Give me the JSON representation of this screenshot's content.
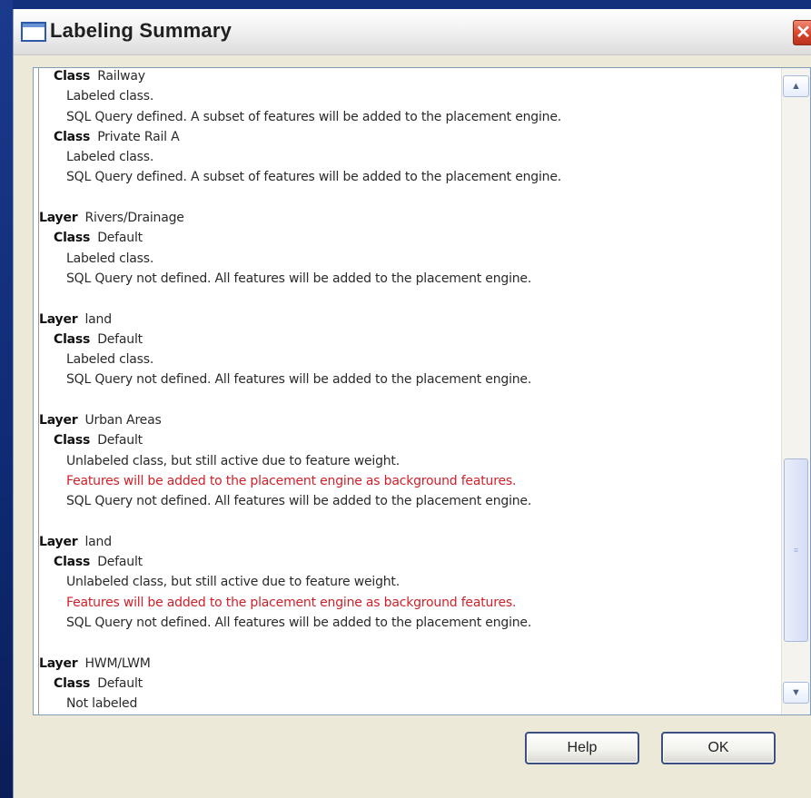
{
  "window": {
    "title": "Labeling Summary",
    "close_symbol": "✕"
  },
  "summary": {
    "rows": [
      {
        "kind": "class",
        "keyword": "Class",
        "name": "Railway"
      },
      {
        "kind": "msg",
        "text": "Labeled class."
      },
      {
        "kind": "msg",
        "text": "SQL Query defined. A subset of features will be added to the placement engine."
      },
      {
        "kind": "class",
        "keyword": "Class",
        "name": "Private Rail A"
      },
      {
        "kind": "msg",
        "text": "Labeled class."
      },
      {
        "kind": "msg",
        "text": "SQL Query defined. A subset of features will be added to the placement engine."
      },
      {
        "kind": "gap"
      },
      {
        "kind": "layer",
        "keyword": "Layer",
        "name": "Rivers/Drainage"
      },
      {
        "kind": "class",
        "keyword": "Class",
        "name": "Default"
      },
      {
        "kind": "msg",
        "text": "Labeled class."
      },
      {
        "kind": "msg",
        "text": "SQL Query not defined. All features will be added to the placement engine."
      },
      {
        "kind": "gap"
      },
      {
        "kind": "layer",
        "keyword": "Layer",
        "name": "land"
      },
      {
        "kind": "class",
        "keyword": "Class",
        "name": "Default"
      },
      {
        "kind": "msg",
        "text": "Labeled class."
      },
      {
        "kind": "msg",
        "text": "SQL Query not defined. All features will be added to the placement engine."
      },
      {
        "kind": "gap"
      },
      {
        "kind": "layer",
        "keyword": "Layer",
        "name": "Urban Areas"
      },
      {
        "kind": "class",
        "keyword": "Class",
        "name": "Default"
      },
      {
        "kind": "msg",
        "text": "Unlabeled class, but still active due to feature weight."
      },
      {
        "kind": "warn",
        "text": "Features will be added to the placement engine as background features."
      },
      {
        "kind": "msg",
        "text": "SQL Query not defined. All features will be added to the placement engine."
      },
      {
        "kind": "gap"
      },
      {
        "kind": "layer",
        "keyword": "Layer",
        "name": "land"
      },
      {
        "kind": "class",
        "keyword": "Class",
        "name": "Default"
      },
      {
        "kind": "msg",
        "text": "Unlabeled class, but still active due to feature weight."
      },
      {
        "kind": "warn",
        "text": "Features will be added to the placement engine as background features."
      },
      {
        "kind": "msg",
        "text": "SQL Query not defined. All features will be added to the placement engine."
      },
      {
        "kind": "gap"
      },
      {
        "kind": "layer",
        "keyword": "Layer",
        "name": "HWM/LWM"
      },
      {
        "kind": "class",
        "keyword": "Class",
        "name": "Default"
      },
      {
        "kind": "msg",
        "text": "Not labeled"
      }
    ],
    "warning_color": "#d0202a"
  },
  "scrollbar": {
    "up_symbol": "▲",
    "down_symbol": "▼",
    "grip_symbol": "≡"
  },
  "buttons": {
    "help_label": "Help",
    "ok_label": "OK"
  }
}
